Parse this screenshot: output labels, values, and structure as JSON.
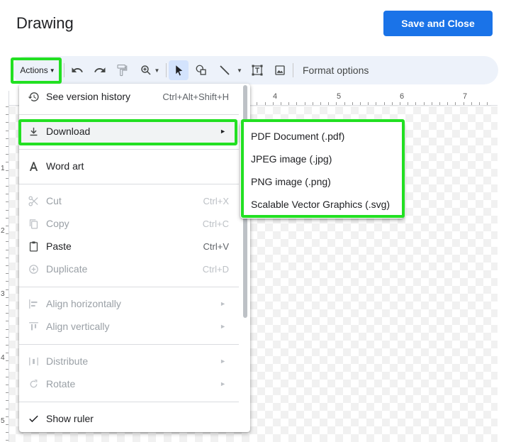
{
  "header": {
    "title": "Drawing",
    "save_label": "Save and Close"
  },
  "toolbar": {
    "actions_label": "Actions",
    "format_options_label": "Format options",
    "icons": [
      "undo-icon",
      "redo-icon",
      "paint-format-icon",
      "zoom-icon",
      "select-pointer-icon",
      "shape-icon",
      "line-icon",
      "text-box-icon",
      "image-icon"
    ]
  },
  "ruler": {
    "h_numbers": [
      "4",
      "5",
      "6",
      "7"
    ],
    "v_numbers": [
      "1",
      "2",
      "3",
      "4",
      "5"
    ]
  },
  "menu": {
    "items": [
      {
        "label": "See version history",
        "shortcut": "Ctrl+Alt+Shift+H",
        "icon": "history-icon",
        "enabled": true
      },
      {
        "label": "Download",
        "shortcut": "",
        "icon": "download-icon",
        "enabled": true,
        "submenu": true
      },
      {
        "label": "Word art",
        "shortcut": "",
        "icon": "word-art-icon",
        "enabled": true
      },
      {
        "label": "Cut",
        "shortcut": "Ctrl+X",
        "icon": "cut-icon",
        "enabled": false
      },
      {
        "label": "Copy",
        "shortcut": "Ctrl+C",
        "icon": "copy-icon",
        "enabled": false
      },
      {
        "label": "Paste",
        "shortcut": "Ctrl+V",
        "icon": "paste-icon",
        "enabled": true
      },
      {
        "label": "Duplicate",
        "shortcut": "Ctrl+D",
        "icon": "duplicate-icon",
        "enabled": false
      },
      {
        "label": "Align horizontally",
        "shortcut": "",
        "icon": "align-horizontal-icon",
        "enabled": false,
        "submenu": true
      },
      {
        "label": "Align vertically",
        "shortcut": "",
        "icon": "align-vertical-icon",
        "enabled": false,
        "submenu": true
      },
      {
        "label": "Distribute",
        "shortcut": "",
        "icon": "distribute-icon",
        "enabled": false,
        "submenu": true
      },
      {
        "label": "Rotate",
        "shortcut": "",
        "icon": "rotate-icon",
        "enabled": false,
        "submenu": true
      },
      {
        "label": "Show ruler",
        "shortcut": "",
        "icon": "checkmark-icon",
        "enabled": true
      }
    ]
  },
  "download_submenu": {
    "items": [
      "PDF Document (.pdf)",
      "JPEG image (.jpg)",
      "PNG image (.png)",
      "Scalable Vector Graphics (.svg)"
    ]
  },
  "colors": {
    "accent": "#1a73e8",
    "highlight": "#22e022",
    "toolbar_bg": "#edf2fa"
  }
}
